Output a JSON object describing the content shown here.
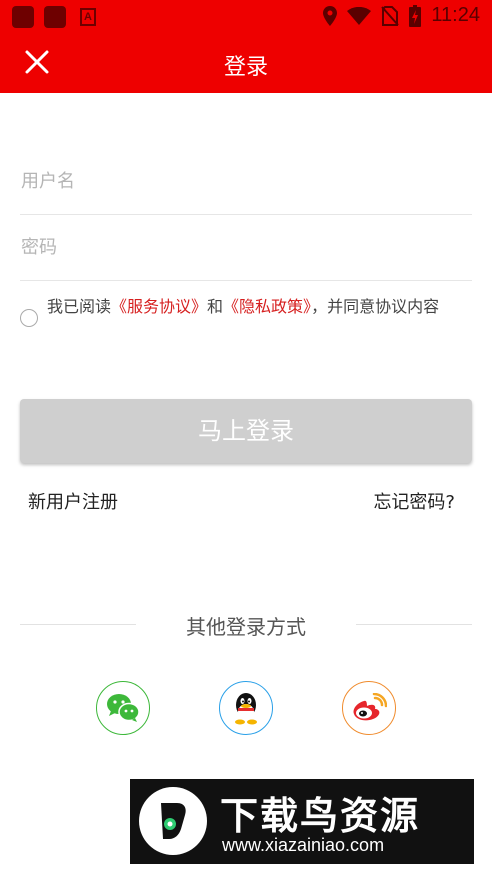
{
  "status_bar": {
    "time": "11:24",
    "icons": [
      "app-icon",
      "app-icon",
      "font-app-icon",
      "location-icon",
      "wifi-icon",
      "no-sim-icon",
      "battery-icon"
    ],
    "color": "#ee0000"
  },
  "header": {
    "title": "登录",
    "close_icon": "close-icon",
    "bg_color": "#ee0000"
  },
  "form": {
    "username_placeholder": "用户名",
    "username_value": "",
    "password_placeholder": "密码",
    "password_value": ""
  },
  "agreement": {
    "checked": false,
    "prefix": "我已阅读",
    "service_link": "《服务协议》",
    "and": "和",
    "privacy_link": "《隐私政策》",
    "suffix": "，并同意协议内容",
    "link_color": "#d61f1f"
  },
  "actions": {
    "login_label": "马上登录",
    "register_label": "新用户注册",
    "forgot_label": "忘记密码?"
  },
  "other_login": {
    "title": "其他登录方式",
    "providers": [
      {
        "name": "wechat",
        "icon": "wechat-icon",
        "color": "#3db83a"
      },
      {
        "name": "qq",
        "icon": "qq-icon",
        "color": "#2aa0e8"
      },
      {
        "name": "weibo",
        "icon": "weibo-icon",
        "color": "#f08c2e"
      }
    ]
  },
  "watermark": {
    "name": "下载鸟资源",
    "url": "www.xiazainiao.com"
  }
}
